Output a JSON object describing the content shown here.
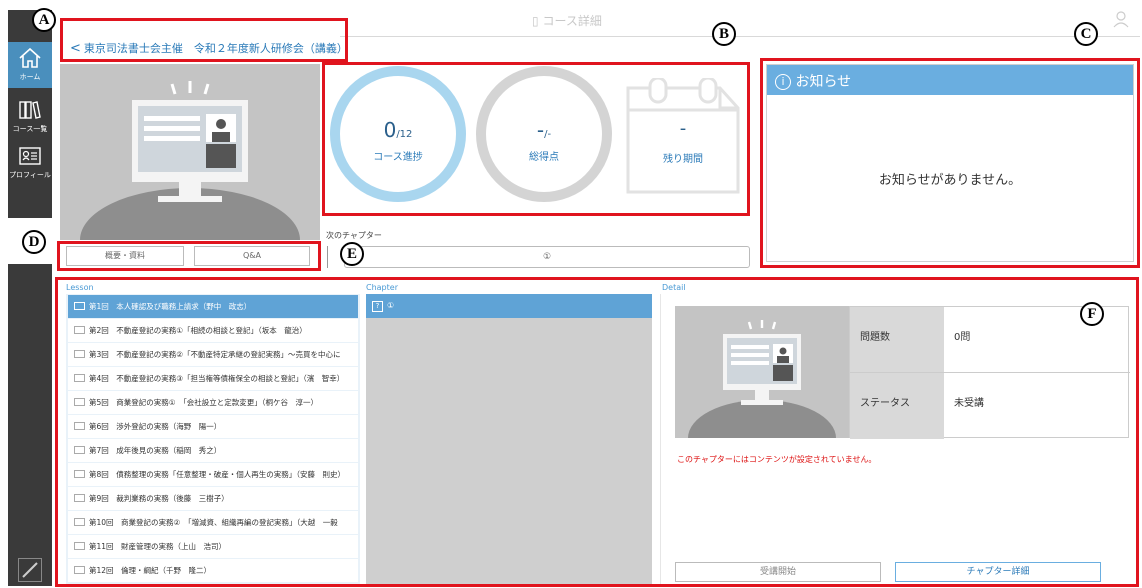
{
  "header": {
    "title": "コース詳細",
    "breadcrumb": "東京司法書士会主催　令和２年度新人研修会（講義）"
  },
  "sidebar": {
    "items": [
      {
        "label": "ホーム"
      },
      {
        "label": "コース一覧"
      },
      {
        "label": "プロフィール"
      }
    ]
  },
  "markers": {
    "a": "A",
    "b": "B",
    "c": "C",
    "d": "D",
    "e": "E",
    "f": "F"
  },
  "stats": {
    "progress_value": "0",
    "progress_total": "/12",
    "progress_label": "コース進捗",
    "score_value": "-",
    "score_total": "/-",
    "score_label": "総得点",
    "remaining_value": "-",
    "remaining_label": "残り期間"
  },
  "tabs": [
    {
      "label": "概要・資料"
    },
    {
      "label": "Q&A"
    }
  ],
  "next_chapter": {
    "label": "次のチャプター",
    "value": "①"
  },
  "notice": {
    "title": "お知らせ",
    "empty_message": "お知らせがありません。"
  },
  "columns": {
    "lesson": "Lesson",
    "chapter": "Chapter",
    "detail": "Detail"
  },
  "lessons": [
    "第1回　本人確認及び職務上請求（野中　政志）",
    "第2回　不動産登記の実務①「相続の相談と登記」（坂本　龍治）",
    "第3回　不動産登記の実務②「不動産特定承継の登記実務」～売買を中心に",
    "第4回　不動産登記の実務③「担当権等債権保全の相談と登記」（濱　智幸）",
    "第5回　商業登記の実務①　「会社設立と定款変更」（桐ケ谷　淳一）",
    "第6回　渉外登記の実務（海野　陽一）",
    "第7回　成年後見の実務（稲岡　秀之）",
    "第8回　債務整理の実務「任意整理・破産・個人再生の実務」（安藤　則史）",
    "第9回　裁判業務の実務（後藤　三樹子）",
    "第10回　商業登記の実務②　「増減資、組織再編の登記実務」（大越　一毅",
    "第11回　財産管理の実務（上山　浩司）",
    "第12回　倫理・綱紀（千野　隆二）"
  ],
  "chapters": [
    {
      "icon": "?",
      "label": "①"
    }
  ],
  "detail": {
    "questions_label": "問題数",
    "questions_value": "0問",
    "status_label": "ステータス",
    "status_value": "未受講",
    "warning": "このチャプターにはコンテンツが設定されていません。",
    "start_button": "受講開始",
    "detail_button": "チャプター詳細"
  },
  "colors": {
    "accent": "#5fa3d6",
    "annotation": "#e0141e",
    "sidebar": "#3a3a3a"
  }
}
